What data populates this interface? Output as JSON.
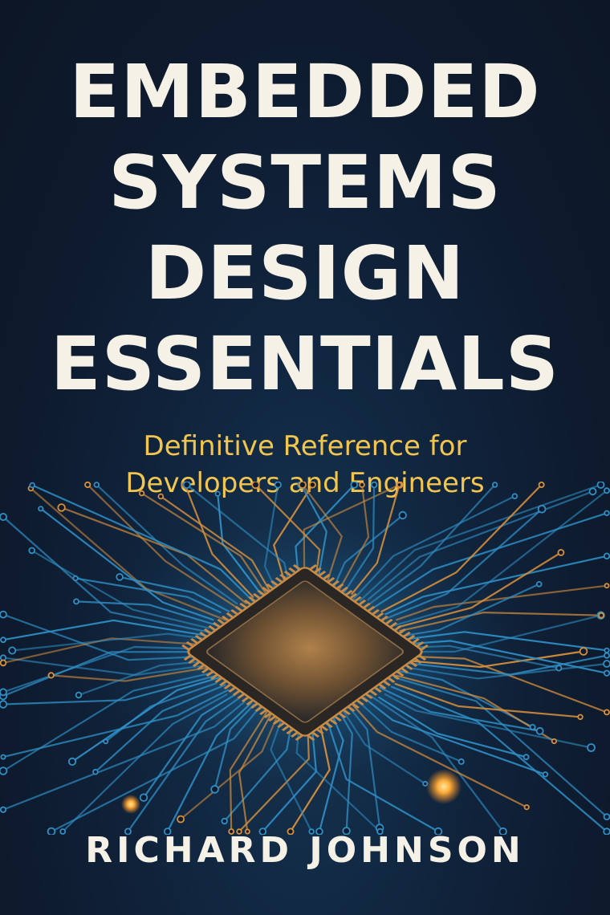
{
  "cover": {
    "title_lines": [
      "EMBEDDED",
      "SYSTEMS",
      "DESIGN",
      "ESSENTIALS"
    ],
    "subtitle_lines": [
      "Definitive Reference for",
      "Developers and Engineers"
    ],
    "author": "RICHARD JOHNSON"
  },
  "colors": {
    "background": "#0e1a2d",
    "title": "#f6f1e6",
    "subtitle": "#f2c54e",
    "trace_blue": "#2f8fc6",
    "trace_orange": "#d8903c",
    "chip": "#7a5a32"
  },
  "artwork": {
    "illustration": "circuit-board-with-microchip"
  }
}
